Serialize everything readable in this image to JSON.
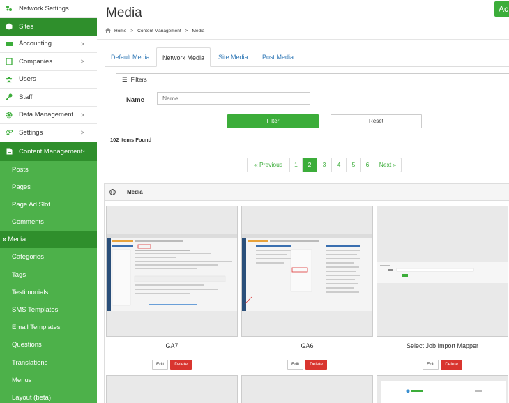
{
  "sidebar": {
    "top_items": [
      {
        "label": "Network Settings",
        "icon": "sitemap-icon",
        "chevron": ""
      },
      {
        "label": "Sites",
        "icon": "cube-icon",
        "chevron": "",
        "dark": true
      },
      {
        "label": "Accounting",
        "icon": "money-icon",
        "chevron": ">"
      },
      {
        "label": "Companies",
        "icon": "building-icon",
        "chevron": ">"
      },
      {
        "label": "Users",
        "icon": "users-icon",
        "chevron": ""
      },
      {
        "label": "Staff",
        "icon": "key-icon",
        "chevron": ""
      },
      {
        "label": "Data Management",
        "icon": "cog-icon",
        "chevron": ">"
      },
      {
        "label": "Settings",
        "icon": "cogs-icon",
        "chevron": ">"
      }
    ],
    "section": {
      "label": "Content Management",
      "icon": "document-icon",
      "chevron": "⌄"
    },
    "sub_items": [
      {
        "label": "Posts"
      },
      {
        "label": "Pages"
      },
      {
        "label": "Page Ad Slot"
      },
      {
        "label": "Comments"
      },
      {
        "label": "Media",
        "active": true,
        "prefix": "»"
      },
      {
        "label": "Categories"
      },
      {
        "label": "Tags"
      },
      {
        "label": "Testimonials"
      },
      {
        "label": "SMS Templates"
      },
      {
        "label": "Email Templates"
      },
      {
        "label": "Questions"
      },
      {
        "label": "Translations"
      },
      {
        "label": "Menus"
      },
      {
        "label": "Layout (beta)"
      }
    ]
  },
  "header": {
    "title": "Media",
    "top_button": "Ac"
  },
  "breadcrumb": {
    "items": [
      "Home",
      "Content Management",
      "Media"
    ],
    "separator": ">"
  },
  "tabs": [
    "Default Media",
    "Network Media",
    "Site Media",
    "Post Media"
  ],
  "filters": {
    "label": "Filters",
    "name_label": "Name",
    "name_placeholder": "Name",
    "name_value": "",
    "filter_btn": "Filter",
    "reset_btn": "Reset"
  },
  "found_text": "102 Items Found",
  "pagination": [
    "« Previous",
    "1",
    "2",
    "3",
    "4",
    "5",
    "6",
    "Next »"
  ],
  "pagination_active": "2",
  "media": {
    "heading": "Media",
    "cards": [
      {
        "title": "GA7",
        "edit": "Edit",
        "delete": "Delete"
      },
      {
        "title": "GA6",
        "edit": "Edit",
        "delete": "Delete"
      },
      {
        "title": "Select Job Import Mapper",
        "edit": "Edit",
        "delete": "Delete"
      }
    ]
  },
  "colors": {
    "sidebar": "#4db14a",
    "sidebar_active": "#2f8f2c",
    "primary": "#3cad3a",
    "danger": "#d9352f",
    "link": "#337ab7"
  }
}
